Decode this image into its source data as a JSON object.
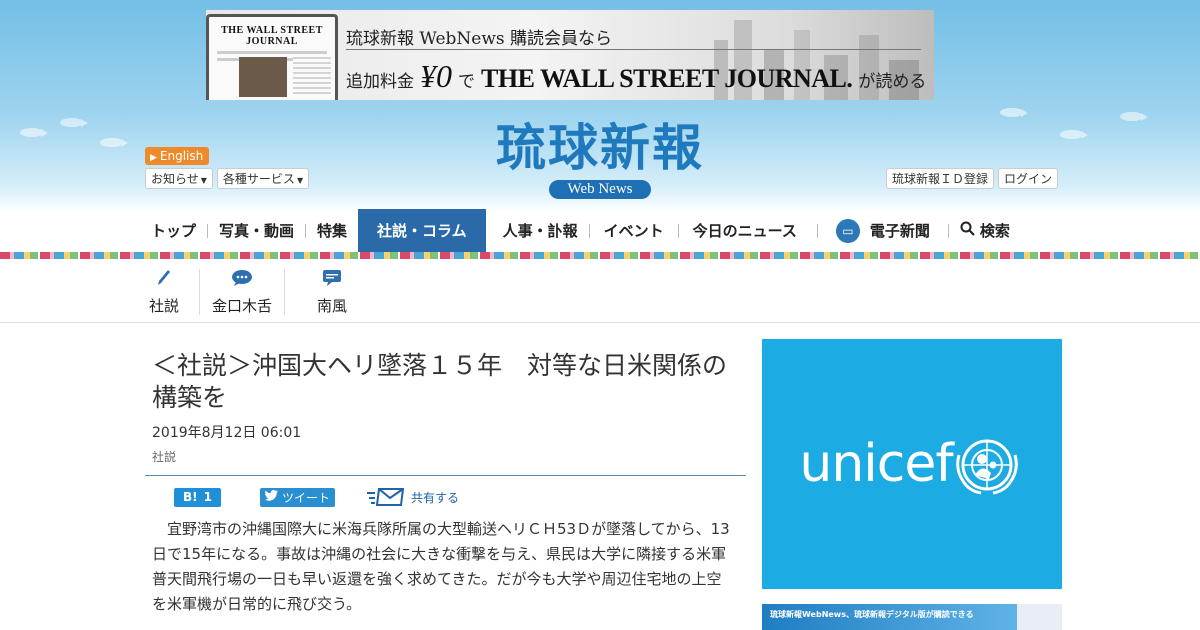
{
  "ad_banner": {
    "line1": "琉球新報 WebNews 購読会員なら",
    "line2_prefix": "追加料金",
    "price": "¥0",
    "line2_mid": "で",
    "brand": "THE WALL STREET JOURNAL.",
    "line2_suffix": "が読める",
    "laptop_masthead": "THE WALL STREET JOURNAL"
  },
  "header": {
    "logo_main": "琉球新報",
    "logo_sub": "Web News",
    "english_label": "English",
    "left_menu": [
      "お知らせ",
      "各種サービス"
    ],
    "right_menu": [
      "琉球新報ＩＤ登録",
      "ログイン"
    ]
  },
  "nav": {
    "items": [
      "トップ",
      "写真・動画",
      "特集",
      "社説・コラム",
      "人事・訃報",
      "イベント",
      "今日のニュース",
      "電子新聞",
      "検索"
    ],
    "active": "社説・コラム"
  },
  "subnav": {
    "items": [
      {
        "label": "社説",
        "icon": "pen-icon"
      },
      {
        "label": "金口木舌",
        "icon": "speech-bubble-icon"
      },
      {
        "label": "南風",
        "icon": "chat-icon"
      }
    ]
  },
  "article": {
    "title": "＜社説＞沖国大ヘリ墜落１５年　対等な日米関係の構築を",
    "date": "2019年8月12日 06:01",
    "category": "社説",
    "hatena_label": "B!",
    "hatena_count": "1",
    "tweet_label": "ツイート",
    "share_label": "共有する",
    "body": "宜野湾市の沖縄国際大に米海兵隊所属の大型輸送ヘリＣＨ53Ｄが墜落してから、13日で15年になる。事故は沖縄の社会に大きな衝撃を与え、県民は大学に隣接する米軍普天間飛行場の一日も早い返還を強く求めてきた。だが今も大学や周辺住宅地の上空を米軍機が日常的に飛び交う。"
  },
  "sidebar": {
    "ad1_text": "unicef",
    "ad1_color": "#1cabe2",
    "ad2_text": "琉球新報WebNews、琉球新報デジタル版が購読できる"
  },
  "colors": {
    "brand_blue": "#1f79bd",
    "nav_active": "#2a6aa8",
    "english_orange": "#ee8a2a"
  }
}
